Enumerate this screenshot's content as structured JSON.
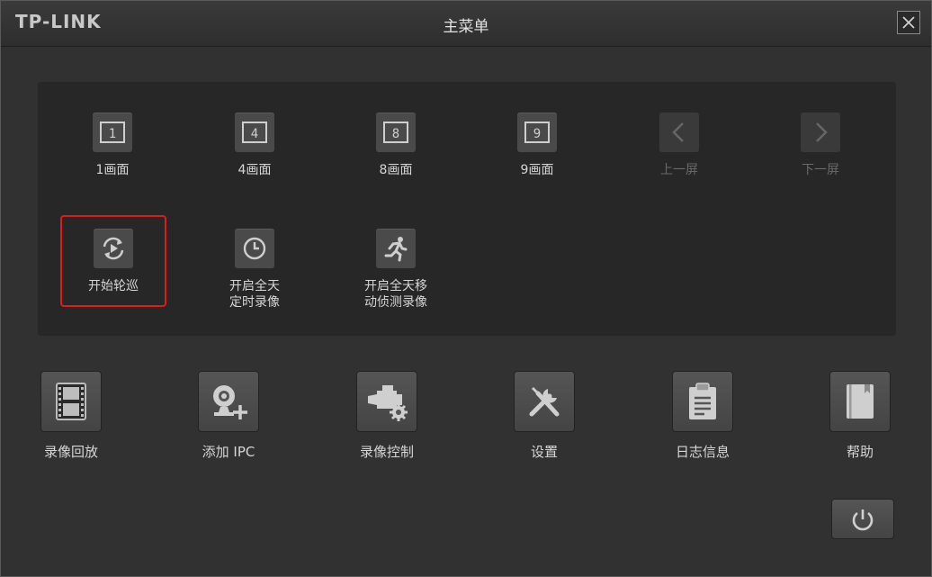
{
  "window": {
    "logo": "TP-LINK",
    "title": "主菜单",
    "close_icon": "close-icon"
  },
  "panel": {
    "row1": [
      {
        "label": "1画面",
        "icon": "layout-1-icon",
        "glyph": "1",
        "enabled": true
      },
      {
        "label": "4画面",
        "icon": "layout-4-icon",
        "glyph": "4",
        "enabled": true
      },
      {
        "label": "8画面",
        "icon": "layout-8-icon",
        "glyph": "8",
        "enabled": true
      },
      {
        "label": "9画面",
        "icon": "layout-9-icon",
        "glyph": "9",
        "enabled": true
      },
      {
        "label": "上一屏",
        "icon": "chevron-left-icon",
        "enabled": false
      },
      {
        "label": "下一屏",
        "icon": "chevron-right-icon",
        "enabled": false
      }
    ],
    "row2": [
      {
        "label": "开始轮巡",
        "icon": "tour-play-icon",
        "enabled": true,
        "highlighted": true
      },
      {
        "label_line1": "开启全天",
        "label_line2": "定时录像",
        "icon": "clock-icon",
        "enabled": true
      },
      {
        "label_line1": "开启全天移",
        "label_line2": "动侦测录像",
        "icon": "running-man-icon",
        "enabled": true
      }
    ]
  },
  "bottom": [
    {
      "label": "录像回放",
      "icon": "film-icon"
    },
    {
      "label": "添加 IPC",
      "icon": "add-camera-icon"
    },
    {
      "label": "录像控制",
      "icon": "camcorder-gear-icon"
    },
    {
      "label": "设置",
      "icon": "tools-icon"
    },
    {
      "label": "日志信息",
      "icon": "clipboard-icon"
    },
    {
      "label": "帮助",
      "icon": "book-icon"
    }
  ],
  "power_icon": "power-icon",
  "colors": {
    "background": "#313131",
    "panel": "#262726",
    "highlight": "#e11b1b",
    "text": "#d6d6d6"
  }
}
